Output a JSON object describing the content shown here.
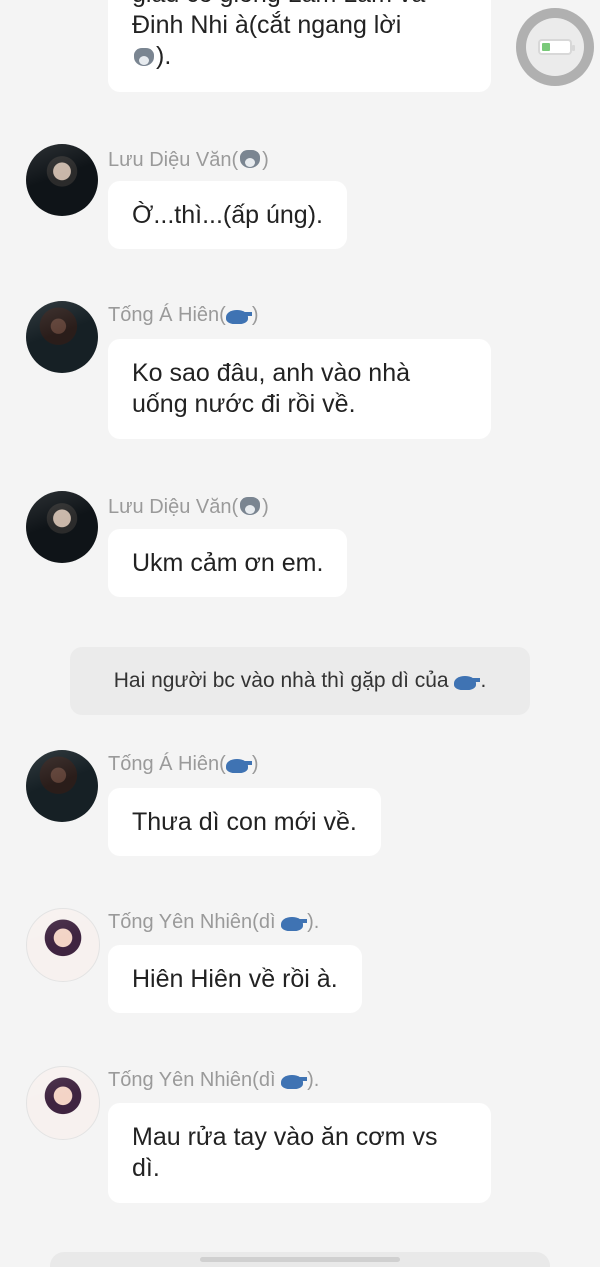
{
  "messages": {
    "top": {
      "text_line1": "giàu có giống Lam Lam và",
      "text_line2": "Đinh Nhi à(cắt ngang lời",
      "text_line3_suffix": ")."
    },
    "m1": {
      "sender": "Lưu Diệu Văn(",
      "sender_suffix": ")",
      "text": "Ờ...thì...(ấp úng)."
    },
    "m2": {
      "sender": "Tống Á Hiên(",
      "sender_suffix": ")",
      "text": "Ko sao đâu, anh vào nhà\nuống nước đi rồi về."
    },
    "m3": {
      "sender": "Lưu Diệu Văn(",
      "sender_suffix": ")",
      "text": "Ukm cảm ơn em."
    },
    "system": {
      "text": "Hai người bc vào nhà thì gặp dì của",
      "suffix": "."
    },
    "m4": {
      "sender": "Tống Á Hiên(",
      "sender_suffix": ")",
      "text": "Thưa dì con mới về."
    },
    "m5": {
      "sender": "Tống Yên Nhiên(dì ",
      "sender_suffix": ").",
      "text": "Hiên Hiên về rồi à."
    },
    "m6": {
      "sender": "Tống Yên Nhiên(dì ",
      "sender_suffix": ").",
      "text": "Mau rửa tay vào ăn cơm vs\ndì."
    }
  },
  "icons": {
    "wolf": "wolf-emoji-icon",
    "whale": "whale-emoji-icon",
    "battery": "battery-charging-icon"
  },
  "colors": {
    "background": "#f4f4f4",
    "bubble": "#ffffff",
    "system_bubble": "#ebebeb",
    "sender_name": "#9a9a9a",
    "text": "#222222"
  }
}
